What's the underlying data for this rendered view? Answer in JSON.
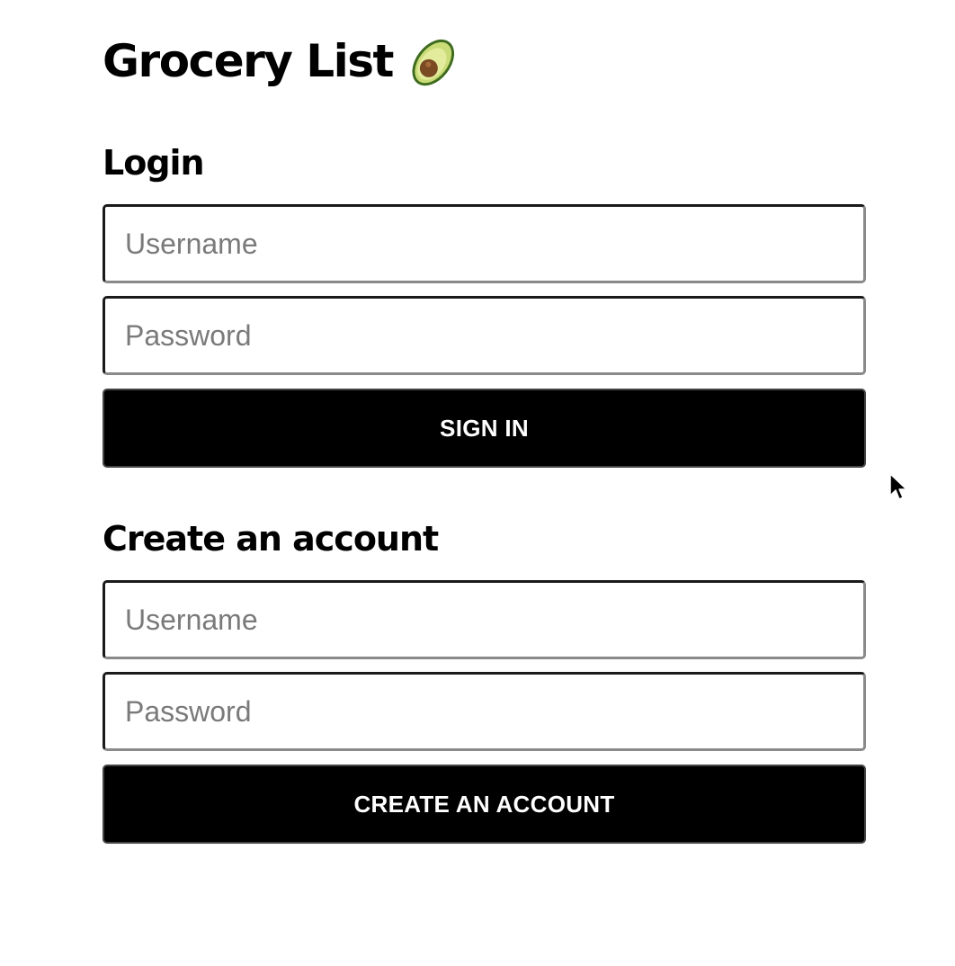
{
  "app": {
    "title": "Grocery List",
    "title_icon": "avocado-icon"
  },
  "login": {
    "heading": "Login",
    "username_placeholder": "Username",
    "password_placeholder": "Password",
    "submit_label": "SIGN IN"
  },
  "signup": {
    "heading": "Create an account",
    "username_placeholder": "Username",
    "password_placeholder": "Password",
    "submit_label": "CREATE AN ACCOUNT"
  },
  "colors": {
    "background": "#ffffff",
    "text": "#000000",
    "button_background": "#000000",
    "button_text": "#ffffff",
    "placeholder": "#7a7a7a"
  },
  "cursor": {
    "icon": "mouse-pointer-icon"
  }
}
